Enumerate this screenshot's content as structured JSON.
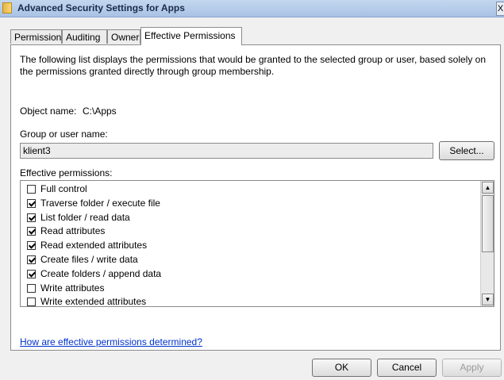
{
  "window": {
    "title": "Advanced Security Settings for Apps",
    "close_glyph": "X"
  },
  "tabs": [
    {
      "label": "Permissions",
      "active": false
    },
    {
      "label": "Auditing",
      "active": false
    },
    {
      "label": "Owner",
      "active": false
    },
    {
      "label": "Effective Permissions",
      "active": true
    }
  ],
  "description": "The following list displays the permissions that would be granted to the selected group or user, based solely on the permissions granted directly through group membership.",
  "object": {
    "label": "Object name:",
    "value": "C:\\Apps"
  },
  "group": {
    "label": "Group or user name:",
    "value": "klient3",
    "select_label": "Select..."
  },
  "effective_permissions": {
    "label": "Effective permissions:",
    "items": [
      {
        "label": "Full control",
        "checked": false
      },
      {
        "label": "Traverse folder / execute file",
        "checked": true
      },
      {
        "label": "List folder / read data",
        "checked": true
      },
      {
        "label": "Read attributes",
        "checked": true
      },
      {
        "label": "Read extended attributes",
        "checked": true
      },
      {
        "label": "Create files / write data",
        "checked": true
      },
      {
        "label": "Create folders / append data",
        "checked": true
      },
      {
        "label": "Write attributes",
        "checked": false
      },
      {
        "label": "Write extended attributes",
        "checked": false
      }
    ]
  },
  "help_link": "How are effective permissions determined?",
  "buttons": {
    "ok": "OK",
    "cancel": "Cancel",
    "apply": "Apply"
  },
  "colors": {
    "link": "#0033cc",
    "titlebar": "#a9c3e6"
  }
}
